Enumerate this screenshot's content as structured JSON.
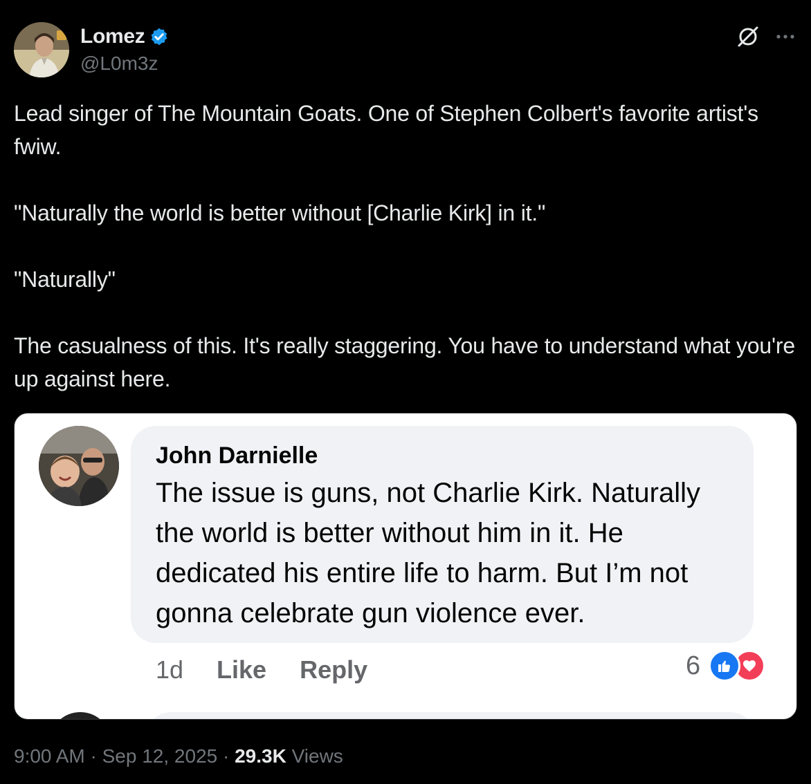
{
  "author": {
    "display_name": "Lomez",
    "handle": "@L0m3z",
    "verified": true,
    "verified_color": "#1d9bf0"
  },
  "actions": {
    "grok_icon": "grok-icon",
    "more_icon": "more-icon"
  },
  "tweet": {
    "paragraphs": [
      "Lead singer of The Mountain Goats. One of Stephen Colbert's favorite artist's fwiw.",
      "\"Naturally the world is better without [Charlie Kirk] in it.\"",
      "\"Naturally\"",
      "The casualness of this. It's really staggering. You have to understand what you're up against here."
    ]
  },
  "embedded_image": {
    "commenter_name": "John Darnielle",
    "comment_text": "The issue is guns, not Charlie Kirk. Naturally the world is better without him in it. He dedicated his entire life to harm. But I’m not gonna celebrate gun violence ever.",
    "time": "1d",
    "like_label": "Like",
    "reply_label": "Reply",
    "reaction_count": "6",
    "like_color": "#1877f2",
    "love_color": "#f33e58"
  },
  "meta": {
    "time": "9:00 AM",
    "separator": "·",
    "date": "Sep 12, 2025",
    "views_count": "29.3K",
    "views_label": "Views"
  }
}
